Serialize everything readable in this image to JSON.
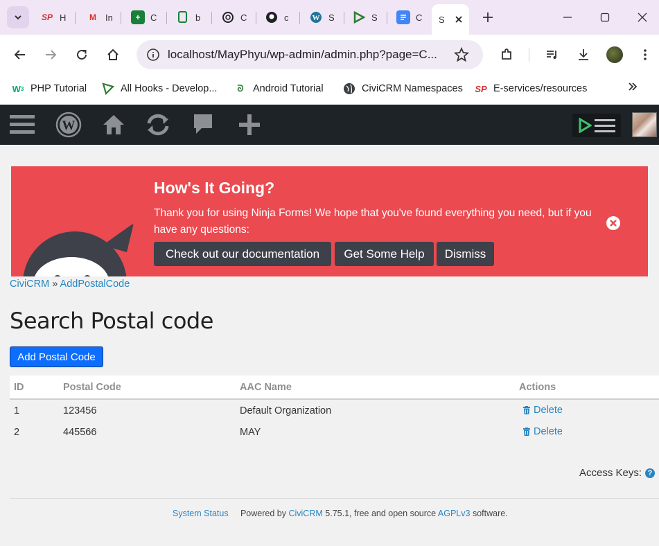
{
  "browser": {
    "tabs": [
      {
        "favicon": "SP",
        "title": "H",
        "color": "#d32f2f"
      },
      {
        "favicon": "M",
        "title": "In",
        "color": "#d93025"
      },
      {
        "favicon": "+",
        "title": "C",
        "color": "#188038"
      },
      {
        "favicon": "doc",
        "title": "b",
        "color": "#188038"
      },
      {
        "favicon": "gpt",
        "title": "C",
        "color": "#202124"
      },
      {
        "favicon": "gh",
        "title": "c",
        "color": "#202124"
      },
      {
        "favicon": "W",
        "title": "S",
        "color": "#21759b"
      },
      {
        "favicon": "tri",
        "title": "S",
        "color": "#2e7d32"
      },
      {
        "favicon": "docs",
        "title": "C",
        "color": "#4285f4"
      }
    ],
    "active_tab": {
      "title": "S"
    },
    "url": "localhost/MayPhyu/wp-admin/admin.php?page=C...",
    "bookmarks": [
      {
        "icon": "w3",
        "label": "PHP Tutorial"
      },
      {
        "icon": "triangle",
        "label": "All Hooks - Develop..."
      },
      {
        "icon": "android",
        "label": "Android Tutorial"
      },
      {
        "icon": "globe",
        "label": "CiviCRM Namespaces"
      },
      {
        "icon": "SP",
        "label": "E-services/resources"
      }
    ]
  },
  "notice": {
    "title": "How's It Going?",
    "message": "Thank you for using Ninja Forms! We hope that you've found everything you need, but if you have any questions:",
    "buttons": {
      "docs": "Check out our documentation",
      "help": "Get Some Help",
      "dismiss": "Dismiss"
    }
  },
  "breadcrumb": {
    "root": "CiviCRM",
    "separator": "»",
    "current": "AddPostalCode"
  },
  "page": {
    "title": "Search Postal code",
    "add_button": "Add Postal Code"
  },
  "table": {
    "headers": {
      "id": "ID",
      "code": "Postal Code",
      "name": "AAC Name",
      "actions": "Actions"
    },
    "rows": [
      {
        "id": "1",
        "code": "123456",
        "name": "Default Organization",
        "action": "Delete"
      },
      {
        "id": "2",
        "code": "445566",
        "name": "MAY",
        "action": "Delete"
      }
    ]
  },
  "access_keys": "Access Keys:",
  "footer": {
    "status": "System Status",
    "powered": "Powered by",
    "civicrm": "CiviCRM",
    "version": "5.75.1, free and open source",
    "license": "AGPLv3",
    "software": "software."
  },
  "colors": {
    "notice_bg": "#ea4a50",
    "adminbar": "#1d2327",
    "link": "#2786c2",
    "primary_button": "#0d6efd"
  }
}
